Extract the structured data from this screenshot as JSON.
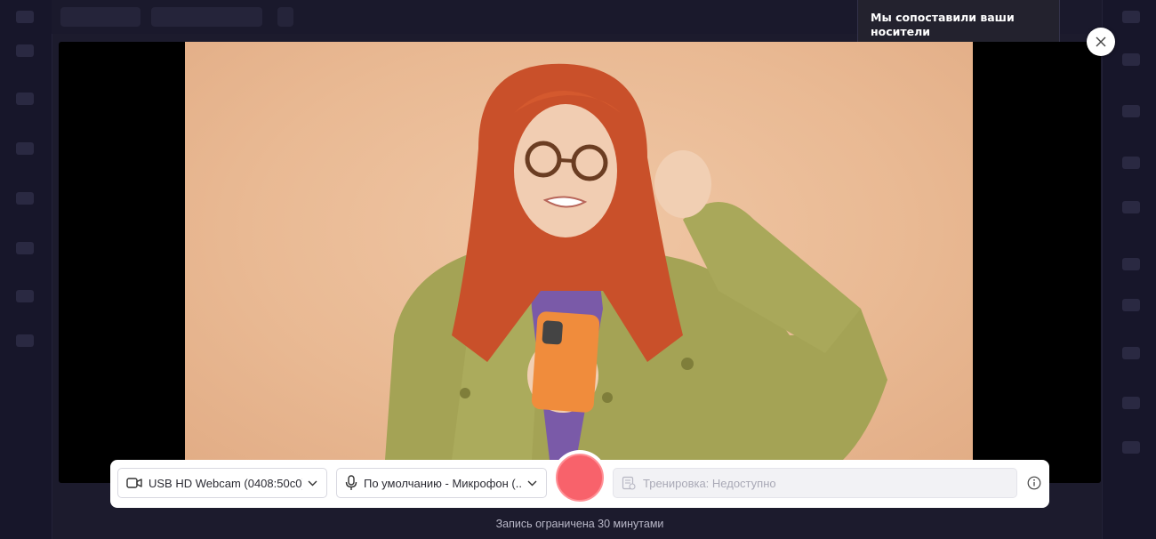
{
  "notification": {
    "text": "Мы сопоставили ваши носители"
  },
  "recorder": {
    "camera_select": {
      "value": "USB HD Webcam (0408:50c0)",
      "icon": "camera-icon"
    },
    "mic_select": {
      "value": "По умолчанию - Микрофон (...",
      "icon": "microphone-icon"
    },
    "record_button": {
      "color": "#f8626b"
    },
    "rehearsal": {
      "text": "Тренировка: Недоступно",
      "icon": "teleprompter-icon"
    },
    "info_icon": "info-icon",
    "close_icon": "close-icon",
    "limit_note": "Запись ограничена 30 минутами"
  },
  "colors": {
    "accent_record": "#f8626b",
    "backdrop": "#1c1b2d"
  }
}
